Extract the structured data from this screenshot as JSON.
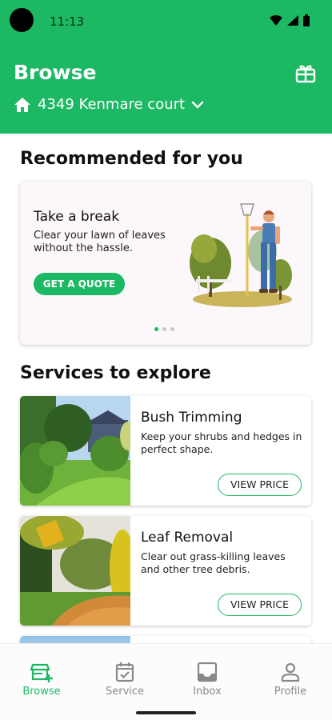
{
  "status_bar": {
    "time": "11:13"
  },
  "header": {
    "title": "Browse",
    "address": "4349 Kenmare court",
    "gift_icon": "gift-icon",
    "home_icon": "home-icon",
    "chevron_icon": "chevron-down-icon"
  },
  "recommended": {
    "title": "Recommended for you",
    "card": {
      "title": "Take a break",
      "subtitle": "Clear your lawn of leaves without the hassle.",
      "button_label": "GET A QUOTE",
      "illustration": "gardener-with-rake-illustration",
      "carousel_pages": 3,
      "carousel_active": 0
    }
  },
  "services": {
    "title": "Services to explore",
    "items": [
      {
        "title": "Bush Trimming",
        "description": "Keep your shrubs and hedges in perfect shape.",
        "button_label": "VIEW PRICE",
        "image": "bush-trimming-photo"
      },
      {
        "title": "Leaf Removal",
        "description": "Clear out grass-killing leaves and other tree debris.",
        "button_label": "VIEW PRICE",
        "image": "leaf-removal-photo"
      }
    ]
  },
  "bottom_nav": {
    "items": [
      {
        "label": "Browse",
        "icon": "storefront-add-icon",
        "active": true
      },
      {
        "label": "Service",
        "icon": "calendar-check-icon",
        "active": false
      },
      {
        "label": "Inbox",
        "icon": "inbox-icon",
        "active": false
      },
      {
        "label": "Profile",
        "icon": "person-icon",
        "active": false
      }
    ]
  },
  "colors": {
    "brand": "#1db863",
    "card_bg": "#fbf7fb",
    "text": "#111111",
    "inactive": "#888888"
  }
}
